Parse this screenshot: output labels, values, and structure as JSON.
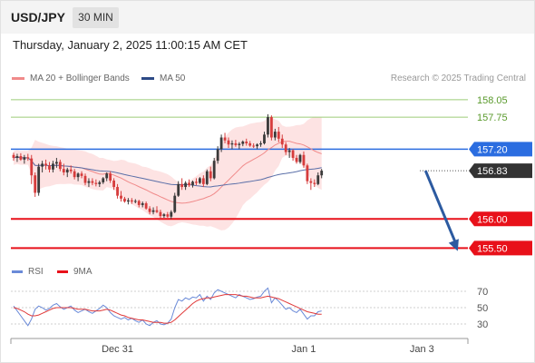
{
  "header": {
    "symbol": "USD/JPY",
    "timeframe": "30 MIN",
    "datetime": "Thursday, January 2, 2025 11:00:15 AM CET"
  },
  "legend": {
    "ma20_label": "MA 20 + Bollinger Bands",
    "ma50_label": "MA 50",
    "rsi_label": "RSI",
    "ma9_label": "9MA",
    "copyright": "Research © 2025 Trading Central"
  },
  "colors": {
    "bull": "#3a3a3a",
    "bear": "#d63c3c",
    "ma20": "#f08a8a",
    "bollinger_fill": "#fde3e3",
    "ma50": "#5a6fa8",
    "resistance_green": "#9ccc78",
    "pivot_blue": "#2b6de0",
    "support_red": "#e8111a",
    "arrow": "#2c5aa0",
    "rsi": "#6a8ad8",
    "rsi_ma": "#e03a3a"
  },
  "chart_data": [
    {
      "type": "candlestick",
      "x_tick_labels": [
        "Dec 31",
        "Jan 1",
        "Jan 3"
      ],
      "x_tick_index": [
        29,
        81,
        114
      ],
      "y_range": [
        155.35,
        158.25
      ],
      "levels": [
        {
          "value": 158.05,
          "label": "158.05",
          "style": "resistance"
        },
        {
          "value": 157.75,
          "label": "157.75",
          "style": "resistance"
        },
        {
          "value": 157.2,
          "label": "157.20",
          "style": "pivot"
        },
        {
          "value": 156.83,
          "label": "156.83",
          "style": "last"
        },
        {
          "value": 156.0,
          "label": "156.00",
          "style": "support"
        },
        {
          "value": 155.5,
          "label": "155.50",
          "style": "support"
        }
      ],
      "forecast_arrow": {
        "from": [
          115,
          156.83
        ],
        "to": [
          124,
          155.45
        ]
      },
      "candles": [
        [
          157.1,
          157.14,
          157.0,
          157.05
        ],
        [
          157.05,
          157.12,
          156.98,
          157.08
        ],
        [
          157.08,
          157.13,
          157.0,
          157.02
        ],
        [
          157.02,
          157.1,
          156.95,
          157.06
        ],
        [
          157.06,
          157.12,
          157.0,
          157.04
        ],
        [
          157.04,
          157.1,
          156.6,
          156.75
        ],
        [
          156.75,
          156.8,
          156.38,
          156.45
        ],
        [
          156.45,
          156.95,
          156.4,
          156.9
        ],
        [
          156.9,
          157.0,
          156.8,
          156.95
        ],
        [
          156.95,
          157.02,
          156.85,
          156.92
        ],
        [
          156.92,
          156.98,
          156.8,
          156.85
        ],
        [
          156.85,
          157.0,
          156.8,
          156.95
        ],
        [
          156.95,
          157.05,
          156.88,
          156.98
        ],
        [
          156.98,
          157.02,
          156.82,
          156.86
        ],
        [
          156.86,
          156.95,
          156.75,
          156.8
        ],
        [
          156.8,
          156.88,
          156.72,
          156.85
        ],
        [
          156.85,
          156.92,
          156.78,
          156.82
        ],
        [
          156.82,
          156.86,
          156.68,
          156.72
        ],
        [
          156.72,
          156.8,
          156.65,
          156.78
        ],
        [
          156.78,
          156.82,
          156.7,
          156.74
        ],
        [
          156.74,
          156.78,
          156.58,
          156.62
        ],
        [
          156.62,
          156.7,
          156.55,
          156.65
        ],
        [
          156.65,
          156.7,
          156.58,
          156.62
        ],
        [
          156.62,
          156.68,
          156.56,
          156.6
        ],
        [
          156.6,
          156.66,
          156.55,
          156.63
        ],
        [
          156.63,
          156.72,
          156.6,
          156.7
        ],
        [
          156.7,
          156.8,
          156.65,
          156.78
        ],
        [
          156.78,
          156.82,
          156.62,
          156.66
        ],
        [
          156.66,
          156.7,
          156.5,
          156.55
        ],
        [
          156.55,
          156.6,
          156.35,
          156.4
        ],
        [
          156.4,
          156.48,
          156.3,
          156.35
        ],
        [
          156.35,
          156.38,
          156.28,
          156.3
        ],
        [
          156.3,
          156.36,
          156.25,
          156.32
        ],
        [
          156.32,
          156.36,
          156.26,
          156.3
        ],
        [
          156.3,
          156.34,
          156.27,
          156.31
        ],
        [
          156.31,
          156.33,
          156.2,
          156.24
        ],
        [
          156.24,
          156.3,
          156.2,
          156.27
        ],
        [
          156.27,
          156.3,
          156.16,
          156.18
        ],
        [
          156.18,
          156.22,
          156.08,
          156.12
        ],
        [
          156.12,
          156.2,
          156.08,
          156.15
        ],
        [
          156.15,
          156.22,
          156.1,
          156.12
        ],
        [
          156.12,
          156.16,
          156.0,
          156.05
        ],
        [
          156.05,
          156.1,
          156.02,
          156.08
        ],
        [
          156.08,
          156.12,
          156.02,
          156.04
        ],
        [
          156.04,
          156.15,
          156.0,
          156.12
        ],
        [
          156.12,
          156.45,
          156.1,
          156.4
        ],
        [
          156.4,
          156.65,
          156.38,
          156.6
        ],
        [
          156.6,
          156.7,
          156.5,
          156.55
        ],
        [
          156.55,
          156.65,
          156.5,
          156.62
        ],
        [
          156.62,
          156.68,
          156.55,
          156.58
        ],
        [
          156.58,
          156.66,
          156.54,
          156.64
        ],
        [
          156.64,
          156.7,
          156.58,
          156.62
        ],
        [
          156.62,
          156.72,
          156.6,
          156.7
        ],
        [
          156.7,
          156.75,
          156.55,
          156.6
        ],
        [
          156.6,
          156.85,
          156.58,
          156.82
        ],
        [
          156.82,
          156.9,
          156.65,
          156.7
        ],
        [
          156.7,
          157.05,
          156.68,
          157.0
        ],
        [
          157.0,
          157.25,
          156.95,
          157.2
        ],
        [
          157.2,
          157.45,
          157.15,
          157.4
        ],
        [
          157.4,
          157.48,
          157.3,
          157.35
        ],
        [
          157.35,
          157.4,
          157.22,
          157.28
        ],
        [
          157.28,
          157.35,
          157.2,
          157.3
        ],
        [
          157.3,
          157.36,
          157.24,
          157.27
        ],
        [
          157.27,
          157.32,
          157.2,
          157.29
        ],
        [
          157.29,
          157.35,
          157.25,
          157.33
        ],
        [
          157.33,
          157.38,
          157.26,
          157.3
        ],
        [
          157.3,
          157.34,
          157.24,
          157.26
        ],
        [
          157.26,
          157.3,
          157.22,
          157.25
        ],
        [
          157.25,
          157.3,
          157.2,
          157.28
        ],
        [
          157.28,
          157.34,
          157.24,
          157.3
        ],
        [
          157.3,
          157.5,
          157.28,
          157.45
        ],
        [
          157.45,
          157.8,
          157.4,
          157.75
        ],
        [
          157.75,
          157.78,
          157.35,
          157.4
        ],
        [
          157.4,
          157.55,
          157.35,
          157.5
        ],
        [
          157.5,
          157.58,
          157.32,
          157.38
        ],
        [
          157.38,
          157.45,
          157.22,
          157.28
        ],
        [
          157.28,
          157.32,
          157.1,
          157.15
        ],
        [
          157.15,
          157.22,
          157.05,
          157.18
        ],
        [
          157.18,
          157.2,
          157.0,
          157.05
        ],
        [
          157.05,
          157.1,
          156.95,
          156.98
        ],
        [
          156.98,
          157.12,
          156.95,
          157.1
        ],
        [
          157.1,
          157.16,
          156.88,
          156.92
        ],
        [
          156.92,
          156.95,
          156.6,
          156.65
        ],
        [
          156.65,
          156.7,
          156.5,
          156.62
        ],
        [
          156.62,
          156.68,
          156.55,
          156.6
        ],
        [
          156.6,
          156.8,
          156.58,
          156.75
        ],
        [
          156.75,
          156.86,
          156.7,
          156.83
        ]
      ]
    },
    {
      "type": "line",
      "title": "RSI",
      "y_ticks": [
        70,
        50,
        30
      ],
      "rsi": [
        52,
        46,
        40,
        34,
        28,
        36,
        48,
        52,
        50,
        47,
        49,
        53,
        55,
        51,
        48,
        50,
        52,
        47,
        44,
        46,
        48,
        45,
        43,
        46,
        49,
        53,
        50,
        44,
        40,
        38,
        36,
        38,
        35,
        37,
        34,
        32,
        35,
        30,
        28,
        32,
        34,
        30,
        29,
        31,
        36,
        50,
        60,
        58,
        62,
        60,
        63,
        62,
        66,
        58,
        64,
        60,
        68,
        72,
        70,
        68,
        66,
        64,
        62,
        66,
        64,
        62,
        60,
        61,
        63,
        64,
        70,
        74,
        56,
        62,
        58,
        53,
        48,
        50,
        46,
        44,
        48,
        42,
        36,
        40,
        40,
        45,
        46
      ],
      "rsi_ma": [
        50,
        49,
        47,
        45,
        42,
        40,
        40,
        41,
        43,
        45,
        47,
        49,
        50,
        50,
        50,
        50,
        50,
        49,
        48,
        48,
        48,
        47,
        46,
        46,
        46,
        47,
        48,
        47,
        45,
        43,
        41,
        40,
        38,
        37,
        36,
        35,
        35,
        34,
        33,
        32,
        32,
        32,
        31,
        31,
        32,
        35,
        39,
        43,
        47,
        51,
        55,
        58,
        60,
        61,
        62,
        62,
        63,
        64,
        65,
        66,
        66,
        66,
        66,
        65,
        64,
        64,
        63,
        62,
        62,
        62,
        63,
        64,
        63,
        62,
        61,
        59,
        57,
        55,
        53,
        51,
        49,
        47,
        45,
        44,
        43,
        42,
        42
      ]
    }
  ]
}
